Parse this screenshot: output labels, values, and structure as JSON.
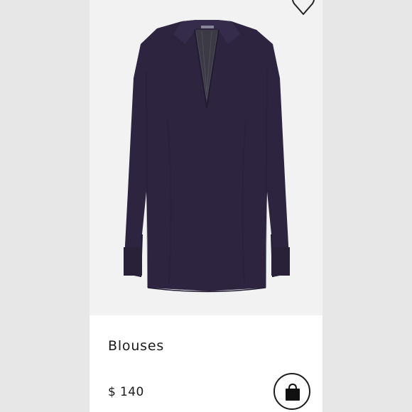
{
  "product": {
    "category": "Blouses",
    "price": "$ 140",
    "image_icon": "blouse-photo",
    "colors": {
      "garment": "#2d2540",
      "garment_shadow": "#221c33",
      "background": "#f2f2f2",
      "side_panels": "#e7e7e7"
    }
  },
  "actions": {
    "favorite_icon": "heart-outline-icon",
    "bag_icon": "shopping-bag-icon"
  }
}
